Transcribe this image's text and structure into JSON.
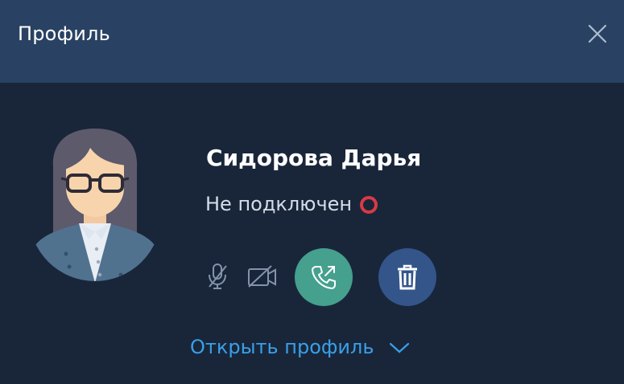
{
  "header": {
    "title": "Профиль"
  },
  "profile": {
    "name": "Сидорова Дарья",
    "status": "Не подключен",
    "status_color": "#d83a45"
  },
  "actions": {
    "mic_icon": "mic-off-icon",
    "camera_icon": "camera-off-icon",
    "call_icon": "phone-outgoing-icon",
    "delete_icon": "trash-icon"
  },
  "footer": {
    "open_profile_label": "Открыть профиль"
  },
  "colors": {
    "header_bg": "#294263",
    "body_bg": "#19263a",
    "call_button": "#45a08e",
    "delete_button": "#33558a",
    "link": "#3a9fe8"
  }
}
